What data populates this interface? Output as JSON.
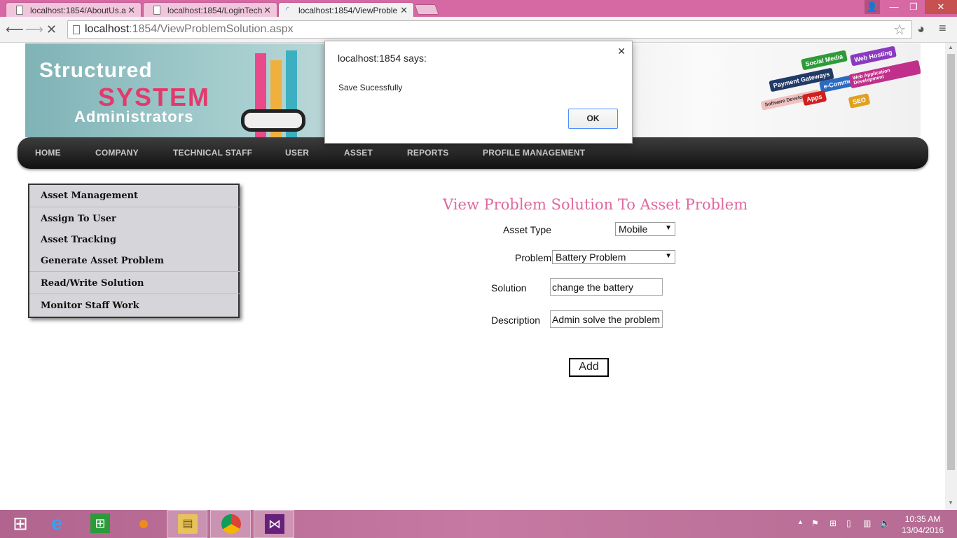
{
  "browser": {
    "tabs": [
      {
        "label": "localhost:1854/AboutUs.a"
      },
      {
        "label": "localhost:1854/LoginTech"
      },
      {
        "label": "localhost:1854/ViewProble"
      }
    ],
    "url_host": "localhost",
    "url_rest": ":1854/ViewProblemSolution.aspx"
  },
  "banner": {
    "line1": "Structured",
    "line2": "SYSTEM",
    "line3": "Administrators",
    "signs": [
      "Social Media",
      "Web Hosting",
      "Payment Gateways",
      "e-Commerce",
      "Web Application Development",
      "Software Development",
      "Apps",
      "SEO"
    ]
  },
  "menu": [
    "HOME",
    "COMPANY",
    "TECHNICAL STAFF",
    "USER",
    "ASSET",
    "REPORTS",
    "PROFILE MANAGEMENT"
  ],
  "sidebar": [
    "Asset Management",
    "Assign To User",
    "Asset Tracking",
    "Generate Asset Problem",
    "Read/Write Solution",
    "Monitor Staff Work"
  ],
  "form": {
    "title": "View Problem Solution To Asset Problem",
    "asset_type_label": "Asset Type",
    "asset_type_value": "Mobile",
    "problem_label": "Problem",
    "problem_value": "Battery Problem",
    "solution_label": "Solution",
    "solution_value": "change the battery",
    "description_label": "Description",
    "description_value": "Admin solve the problem",
    "add_label": "Add"
  },
  "dialog": {
    "title": "localhost:1854 says:",
    "message": "Save Sucessfully",
    "ok_label": "OK"
  },
  "taskbar": {
    "time": "10:35 AM",
    "date": "13/04/2016"
  },
  "colors": {
    "tabbar": "#d668a3",
    "title_pink": "#e0689e",
    "menubar": "#1a1a1a"
  }
}
